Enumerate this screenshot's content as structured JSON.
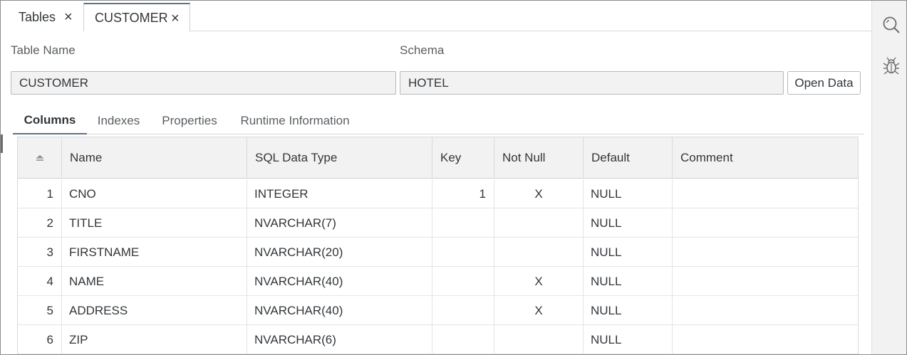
{
  "tabs": [
    {
      "label": "Tables",
      "close": "×"
    },
    {
      "label": "CUSTOMER",
      "close": "×"
    }
  ],
  "form": {
    "table_name_label": "Table Name",
    "schema_label": "Schema",
    "table_name_value": "CUSTOMER",
    "schema_value": "HOTEL",
    "open_data_label": "Open Data"
  },
  "subtabs": [
    "Columns",
    "Indexes",
    "Properties",
    "Runtime Information"
  ],
  "grid": {
    "headers": [
      "Name",
      "SQL Data Type",
      "Key",
      "Not Null",
      "Default",
      "Comment"
    ],
    "rows": [
      {
        "index": "1",
        "name": "CNO",
        "type": "INTEGER",
        "key": "1",
        "not_null": "X",
        "default": "NULL",
        "comment": ""
      },
      {
        "index": "2",
        "name": "TITLE",
        "type": "NVARCHAR(7)",
        "key": "",
        "not_null": "",
        "default": "NULL",
        "comment": ""
      },
      {
        "index": "3",
        "name": "FIRSTNAME",
        "type": "NVARCHAR(20)",
        "key": "",
        "not_null": "",
        "default": "NULL",
        "comment": ""
      },
      {
        "index": "4",
        "name": "NAME",
        "type": "NVARCHAR(40)",
        "key": "",
        "not_null": "X",
        "default": "NULL",
        "comment": ""
      },
      {
        "index": "5",
        "name": "ADDRESS",
        "type": "NVARCHAR(40)",
        "key": "",
        "not_null": "X",
        "default": "NULL",
        "comment": ""
      },
      {
        "index": "6",
        "name": "ZIP",
        "type": "NVARCHAR(6)",
        "key": "",
        "not_null": "",
        "default": "NULL",
        "comment": ""
      }
    ]
  },
  "icons": {
    "side_search": "search-icon",
    "side_debug": "bug-icon",
    "sort": "sort-icon"
  },
  "colors": {
    "accent": "#5b738b",
    "panel": "#f2f2f2"
  }
}
